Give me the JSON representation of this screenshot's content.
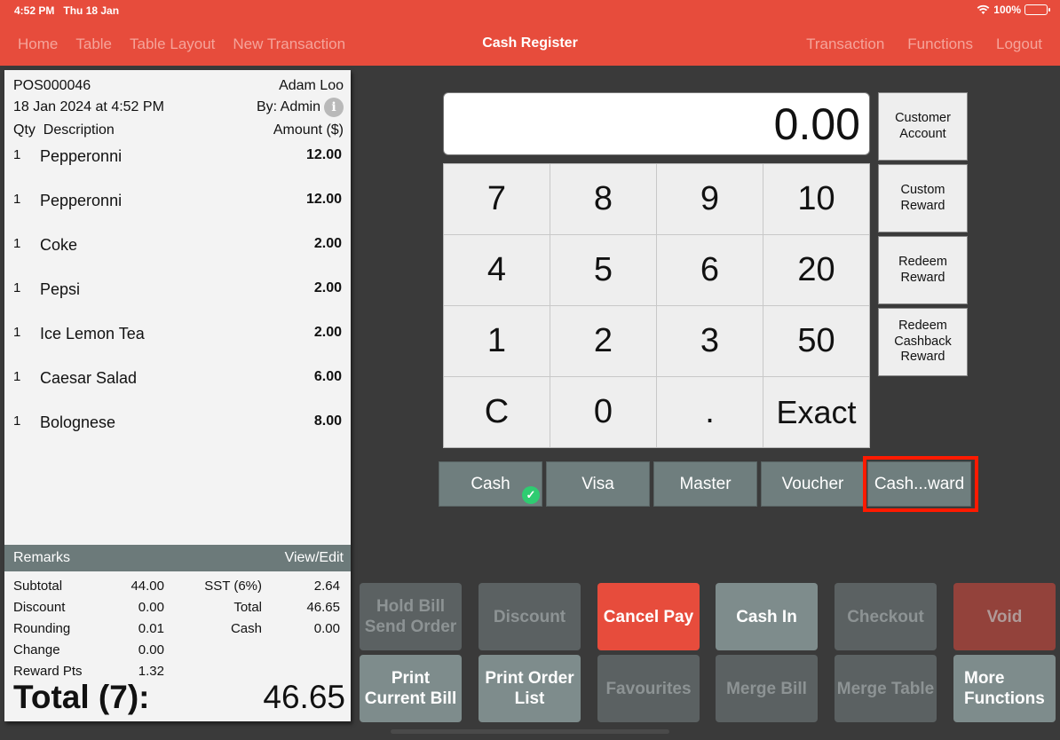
{
  "status_bar": {
    "time": "4:52 PM",
    "date": "Thu 18 Jan",
    "battery": "100%",
    "battery_level": 1.0
  },
  "nav": {
    "left": [
      "Home",
      "Table",
      "Table Layout",
      "New Transaction"
    ],
    "title": "Cash Register",
    "right": [
      "Transaction",
      "Functions",
      "Logout"
    ]
  },
  "receipt": {
    "order_no": "POS000046",
    "customer": "Adam Loo",
    "datetime": "18 Jan 2024 at 4:52 PM",
    "by": "By: Admin",
    "col_qty": "Qty",
    "col_desc": "Description",
    "col_amount": "Amount ($)",
    "items": [
      {
        "qty": "1",
        "desc": "Pepperonni",
        "amount": "12.00"
      },
      {
        "qty": "1",
        "desc": "Pepperonni",
        "amount": "12.00"
      },
      {
        "qty": "1",
        "desc": "Coke",
        "amount": "2.00"
      },
      {
        "qty": "1",
        "desc": "Pepsi",
        "amount": "2.00"
      },
      {
        "qty": "1",
        "desc": "Ice Lemon Tea",
        "amount": "2.00"
      },
      {
        "qty": "1",
        "desc": "Caesar Salad",
        "amount": "6.00"
      },
      {
        "qty": "1",
        "desc": "Bolognese",
        "amount": "8.00"
      }
    ],
    "remarks_label": "Remarks",
    "remarks_action": "View/Edit",
    "totals": [
      {
        "l1": "Subtotal",
        "v1": "44.00",
        "l2": "SST (6%)",
        "v2": "2.64"
      },
      {
        "l1": "Discount",
        "v1": "0.00",
        "l2": "Total",
        "v2": "46.65"
      },
      {
        "l1": "Rounding",
        "v1": "0.01",
        "l2": "Cash",
        "v2": "0.00"
      },
      {
        "l1": "Change",
        "v1": "0.00",
        "l2": "",
        "v2": ""
      },
      {
        "l1": "Reward Pts",
        "v1": "1.32",
        "l2": "",
        "v2": ""
      }
    ],
    "grand_label": "Total (7):",
    "grand_value": "46.65"
  },
  "display_value": "0.00",
  "keypad": [
    "7",
    "8",
    "9",
    "10",
    "4",
    "5",
    "6",
    "20",
    "1",
    "2",
    "3",
    "50",
    "C",
    "0",
    ".",
    "Exact"
  ],
  "side_buttons": [
    "Customer\nAccount",
    "Custom\nReward",
    "Redeem\nReward",
    "Redeem\nCashback\nReward"
  ],
  "payment_methods": [
    {
      "label": "Cash",
      "selected": true
    },
    {
      "label": "Visa",
      "selected": false
    },
    {
      "label": "Master",
      "selected": false
    },
    {
      "label": "Voucher",
      "selected": false
    },
    {
      "label": "Cash...ward",
      "selected": false,
      "highlighted": true
    }
  ],
  "functions": [
    {
      "label": "Hold Bill\nSend Order",
      "state": "disabled"
    },
    {
      "label": "Discount",
      "state": "disabled"
    },
    {
      "label": "Cancel Pay",
      "state": "primary"
    },
    {
      "label": "Cash In",
      "state": "active"
    },
    {
      "label": "Checkout",
      "state": "disabled"
    },
    {
      "label": "Void",
      "state": "disabled-red"
    },
    {
      "label": "Print\nCurrent Bill",
      "state": "active"
    },
    {
      "label": "Print Order\nList",
      "state": "active"
    },
    {
      "label": "Favourites",
      "state": "disabled"
    },
    {
      "label": "Merge Bill",
      "state": "disabled"
    },
    {
      "label": "Merge Table",
      "state": "disabled"
    },
    {
      "label": "More\nFunctions",
      "state": "active"
    }
  ],
  "colors": {
    "brand": "#e74c3c",
    "check": "#2ecc71",
    "highlight": "#ff1a00"
  }
}
